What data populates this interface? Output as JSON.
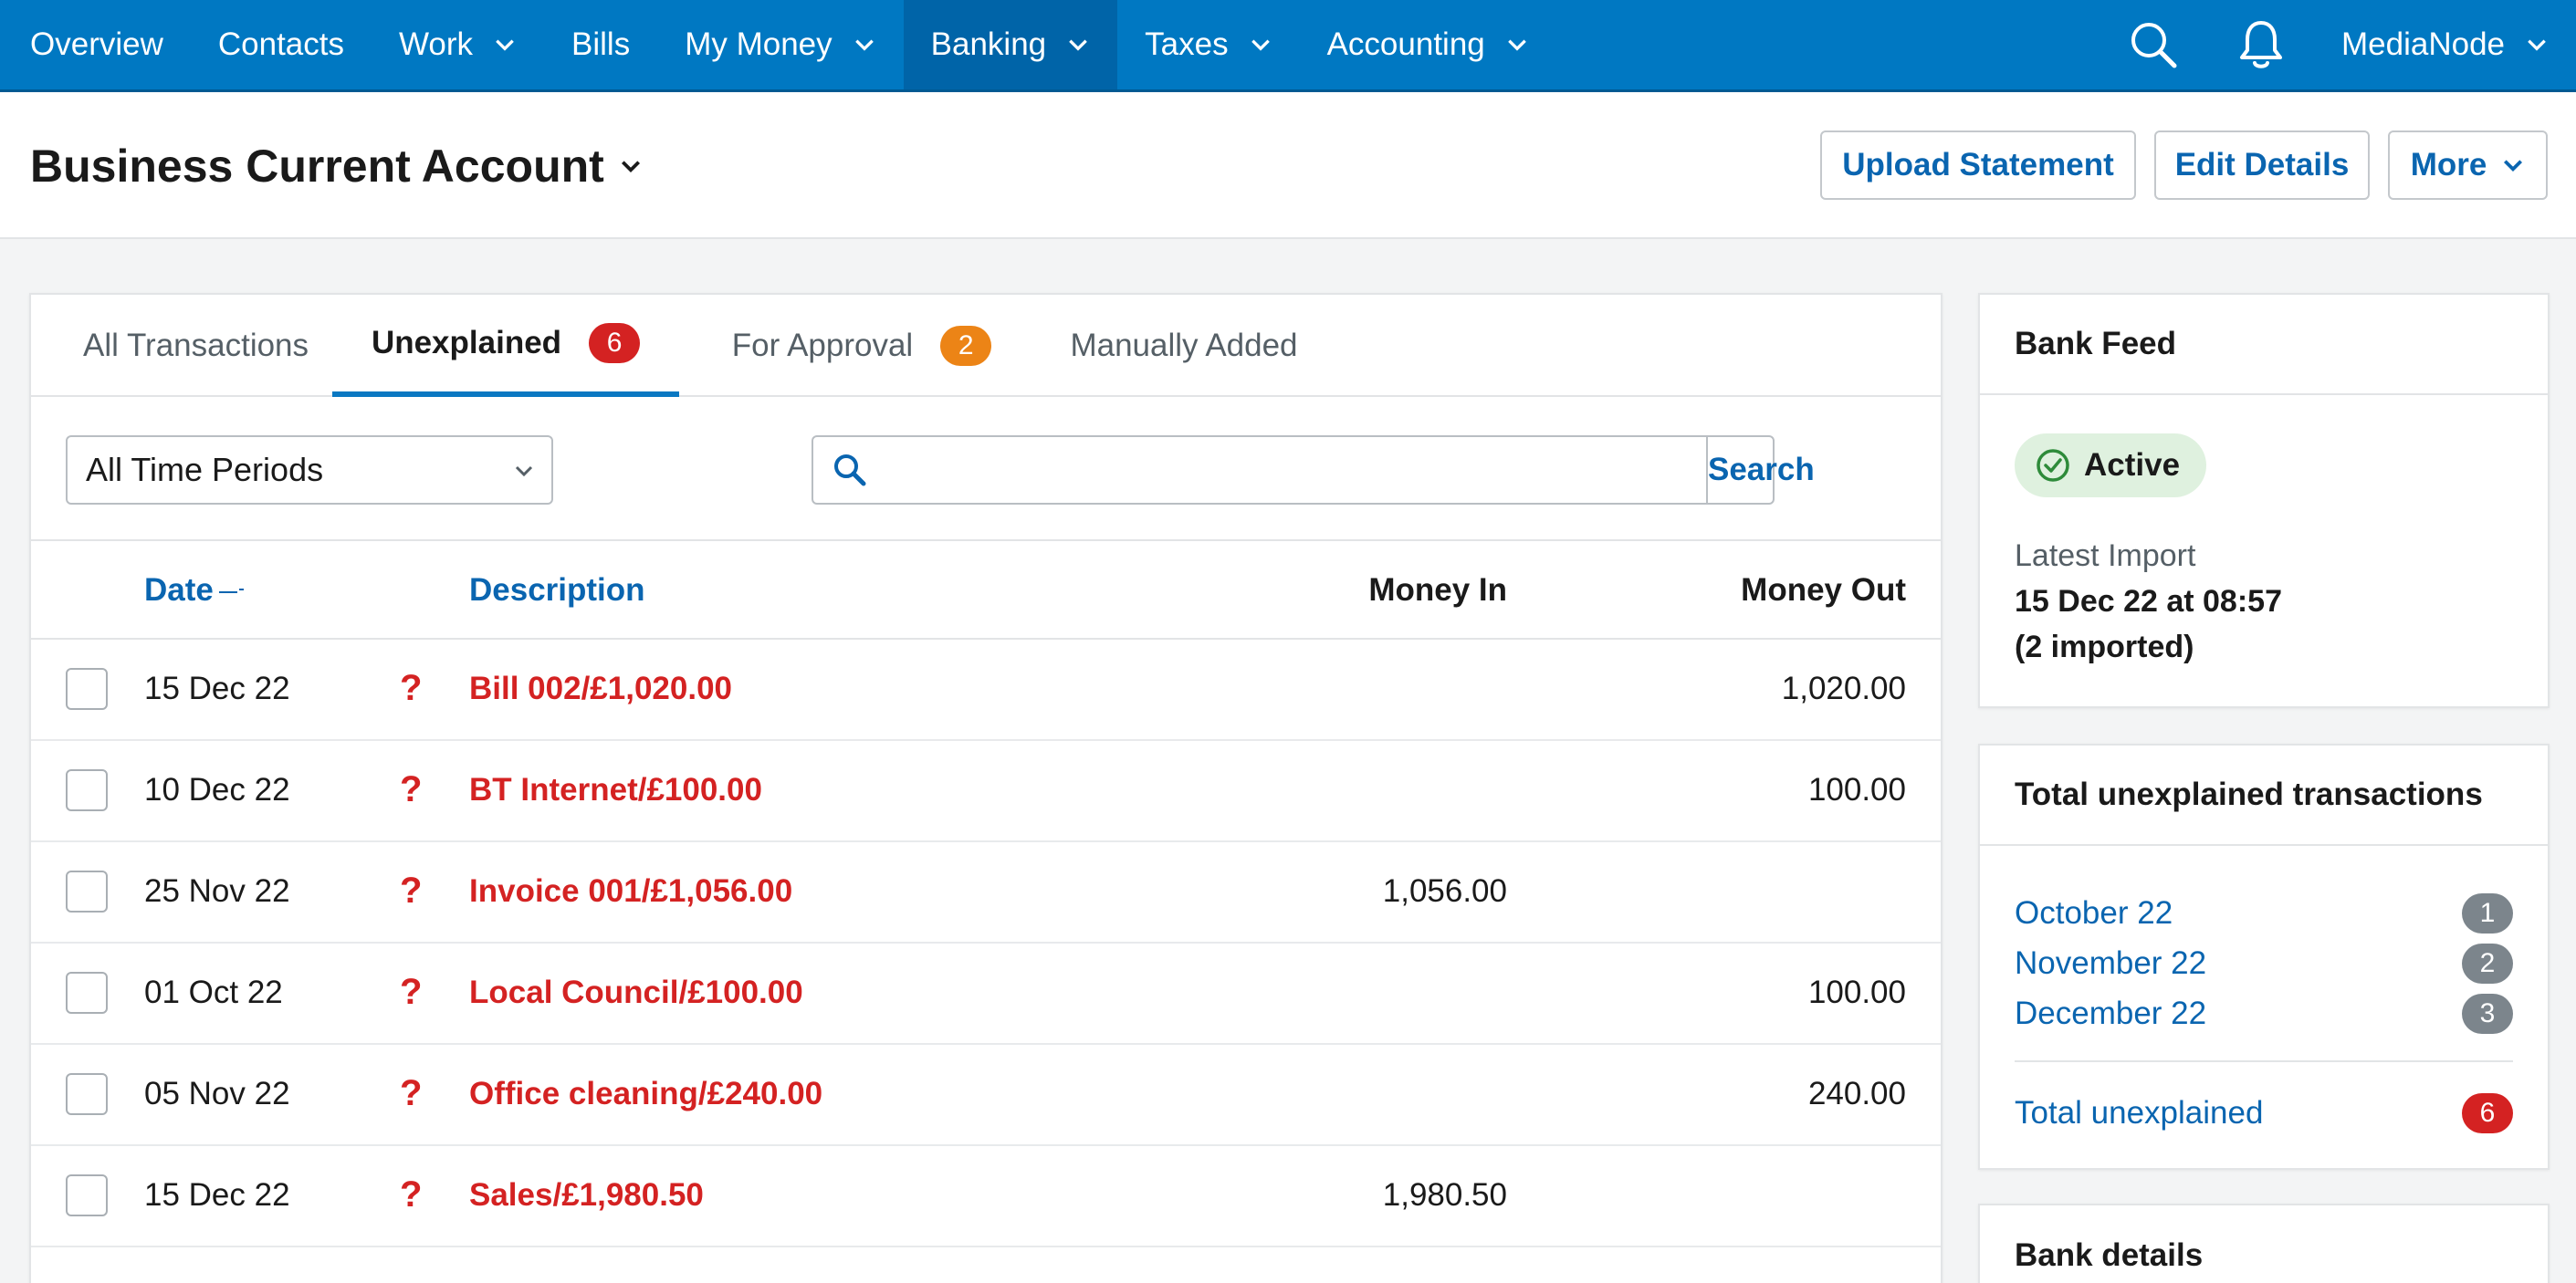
{
  "nav": {
    "items": [
      {
        "label": "Overview",
        "dropdown": false,
        "active": false
      },
      {
        "label": "Contacts",
        "dropdown": false,
        "active": false
      },
      {
        "label": "Work",
        "dropdown": true,
        "active": false
      },
      {
        "label": "Bills",
        "dropdown": false,
        "active": false
      },
      {
        "label": "My Money",
        "dropdown": true,
        "active": false
      },
      {
        "label": "Banking",
        "dropdown": true,
        "active": true
      },
      {
        "label": "Taxes",
        "dropdown": true,
        "active": false
      },
      {
        "label": "Accounting",
        "dropdown": true,
        "active": false
      }
    ],
    "user_label": "MediaNode",
    "search_icon": "search-icon",
    "bell_icon": "bell-icon"
  },
  "header": {
    "title": "Business Current Account",
    "upload_label": "Upload Statement",
    "edit_label": "Edit Details",
    "more_label": "More"
  },
  "tabs": [
    {
      "label": "All Transactions",
      "badge": null
    },
    {
      "label": "Unexplained",
      "badge": "6",
      "badge_color": "red",
      "active": true
    },
    {
      "label": "For Approval",
      "badge": "2",
      "badge_color": "orange"
    },
    {
      "label": "Manually Added",
      "badge": null
    }
  ],
  "filters": {
    "period_value": "All Time Periods",
    "search_value": "",
    "search_button": "Search"
  },
  "table": {
    "columns": {
      "date": "Date",
      "description": "Description",
      "money_in": "Money In",
      "money_out": "Money Out"
    },
    "rows": [
      {
        "date": "15 Dec 22",
        "description": "Bill 002/£1,020.00",
        "money_in": "",
        "money_out": "1,020.00"
      },
      {
        "date": "10 Dec 22",
        "description": "BT Internet/£100.00",
        "money_in": "",
        "money_out": "100.00"
      },
      {
        "date": "25 Nov 22",
        "description": "Invoice 001/£1,056.00",
        "money_in": "1,056.00",
        "money_out": ""
      },
      {
        "date": "01 Oct 22",
        "description": "Local Council/£100.00",
        "money_in": "",
        "money_out": "100.00"
      },
      {
        "date": "05 Nov 22",
        "description": "Office cleaning/£240.00",
        "money_in": "",
        "money_out": "240.00"
      },
      {
        "date": "15 Dec 22",
        "description": "Sales/£1,980.50",
        "money_in": "1,980.50",
        "money_out": ""
      }
    ],
    "unexplained_marker": "?"
  },
  "bank_feed": {
    "title": "Bank Feed",
    "status": "Active",
    "latest_import_label": "Latest Import",
    "latest_import_value": "15 Dec 22 at 08:57",
    "imported_count": "(2 imported)"
  },
  "unexplained_summary": {
    "title": "Total unexplained transactions",
    "months": [
      {
        "label": "October 22",
        "count": "1"
      },
      {
        "label": "November 22",
        "count": "2"
      },
      {
        "label": "December 22",
        "count": "3"
      }
    ],
    "total_label": "Total unexplained",
    "total_count": "6"
  },
  "bank_details": {
    "title": "Bank details"
  },
  "colors": {
    "brand_blue": "#0078c2",
    "link_blue": "#0a65b0",
    "alert_red": "#d42222",
    "warning_orange": "#ec8416",
    "success_green": "#2e8b3a"
  }
}
